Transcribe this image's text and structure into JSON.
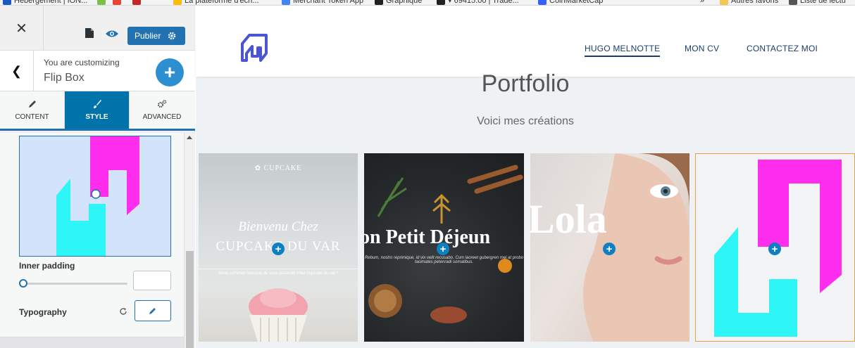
{
  "bookmarks": [
    {
      "label": "Hébergement | ION...",
      "color": "#1a56c4"
    },
    {
      "label": "",
      "color": "#7bc043"
    },
    {
      "label": "",
      "color": "#ea4335"
    },
    {
      "label": "",
      "color": "#c62828"
    },
    {
      "label": "La plateforme d'écri...",
      "color": "#fbbc05"
    },
    {
      "label": "Merchant Token App",
      "color": "#4285f4"
    },
    {
      "label": "Graphique",
      "color": "#222222"
    },
    {
      "label": "▾ 69415.00 | Trade...",
      "color": "#222222"
    },
    {
      "label": "CoinMarketCap",
      "color": "#3861fb"
    },
    {
      "label": "»",
      "color": ""
    },
    {
      "label": "Autres favoris",
      "color": "#f2c94c"
    },
    {
      "label": "Liste de lectu",
      "color": "#555555"
    }
  ],
  "customizer": {
    "publish_label": "Publier",
    "customizing_label": "You are customizing",
    "customizing_title": "Flip Box",
    "tabs": [
      {
        "label": "CONTENT",
        "icon": "pencil-icon",
        "active": false
      },
      {
        "label": "STYLE",
        "icon": "brush-icon",
        "active": true
      },
      {
        "label": "ADVANCED",
        "icon": "gears-icon",
        "active": false
      }
    ],
    "inner_padding_label": "Inner padding",
    "inner_padding_value": "",
    "inner_padding_slider": 0,
    "typography_label": "Typography"
  },
  "site": {
    "nav": [
      {
        "label": "HUGO MELNOTTE",
        "active": true
      },
      {
        "label": "MON CV",
        "active": false
      },
      {
        "label": "CONTACTEZ MOI",
        "active": false
      }
    ],
    "section_title": "Portfolio",
    "section_subtitle": "Voici mes créations",
    "cards": [
      {
        "brand": "✿ CUPCAKE",
        "script": "Bienvenu Chez",
        "headline": "CUPCAKE DU VAR",
        "small": "Nous sommes heureux de vous accueillir chez cupcake du var !"
      },
      {
        "headline": "on Petit Déjeun",
        "small": "Rebum, nostro reprimique, id vix velit recusabo. Cum laoreet gubergren mei at probo tacimates petenradi somatibus."
      },
      {
        "headline": "Lola"
      },
      {}
    ]
  },
  "colors": {
    "accent": "#2271b1",
    "magenta": "#ff2ded",
    "cyan": "#2ef6f6",
    "logo_blue": "#4a55cf",
    "card_plus": "#0f7fc3"
  }
}
